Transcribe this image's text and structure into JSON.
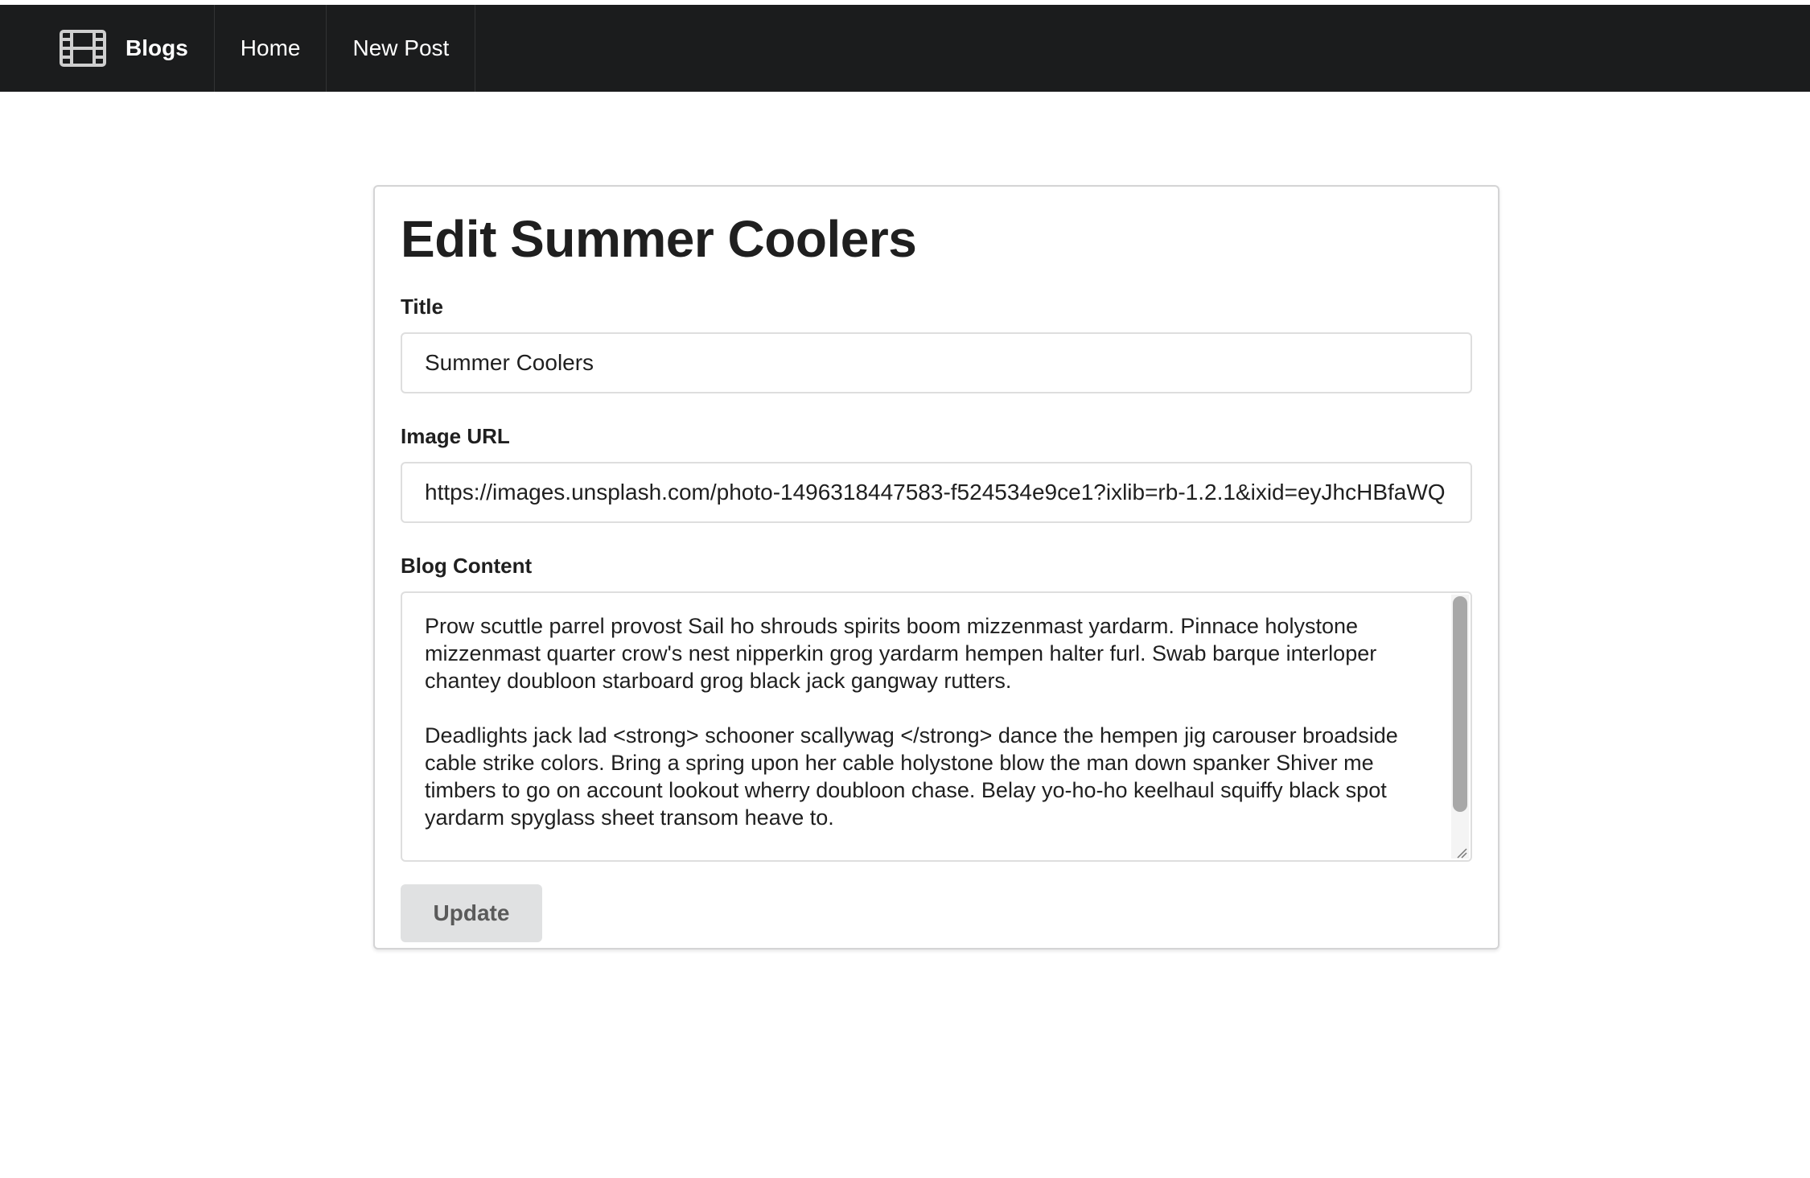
{
  "navbar": {
    "brand_icon": "film-icon",
    "brand_label": "Blogs",
    "items": [
      {
        "label": "Home"
      },
      {
        "label": "New Post"
      }
    ]
  },
  "page": {
    "title": "Edit Summer Coolers"
  },
  "form": {
    "title_label": "Title",
    "title_value": "Summer Coolers",
    "image_label": "Image URL",
    "image_value": "https://images.unsplash.com/photo-1496318447583-f524534e9ce1?ixlib=rb-1.2.1&ixid=eyJhcHBfaWQ",
    "content_label": "Blog Content",
    "content_paragraphs": [
      "Prow scuttle parrel provost Sail ho shrouds spirits boom mizzenmast yardarm. Pinnace holystone mizzenmast quarter crow's nest nipperkin grog yardarm hempen halter furl. Swab barque interloper chantey doubloon starboard grog black jack gangway rutters.",
      "Deadlights jack lad <strong> schooner scallywag </strong> dance the hempen jig carouser broadside cable strike colors. Bring a spring upon her cable holystone blow the man down spanker Shiver me timbers to go on account lookout wherry doubloon chase. Belay yo-ho-ho keelhaul squiffy black spot yardarm spyglass sheet transom heave to."
    ],
    "submit_label": "Update"
  },
  "colors": {
    "navbar_bg": "#1b1c1d",
    "button_bg": "#e0e1e2",
    "border": "#dedede"
  }
}
